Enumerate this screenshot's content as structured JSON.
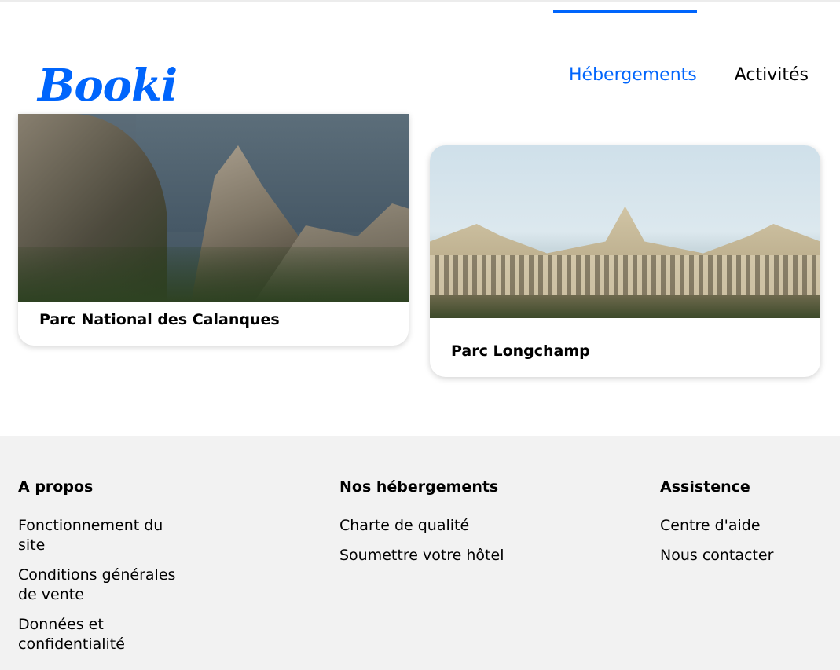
{
  "brand": {
    "logo": "Booki",
    "accent": "#0065fc"
  },
  "nav": {
    "items": [
      {
        "label": "Hébergements",
        "active": true
      },
      {
        "label": "Activités",
        "active": false
      }
    ]
  },
  "cards": [
    {
      "title": "Parc National des Calanques"
    },
    {
      "title": "Parc Longchamp"
    }
  ],
  "footer": {
    "columns": [
      {
        "heading": "A propos",
        "links": [
          "Fonctionnement du site",
          "Conditions générales de vente",
          "Données et confidentialité"
        ]
      },
      {
        "heading": "Nos hébergements",
        "links": [
          "Charte de qualité",
          "Soumettre votre hôtel"
        ]
      },
      {
        "heading": "Assistence",
        "links": [
          "Centre d'aide",
          "Nous contacter"
        ]
      }
    ],
    "background": "#f2f2f2"
  }
}
